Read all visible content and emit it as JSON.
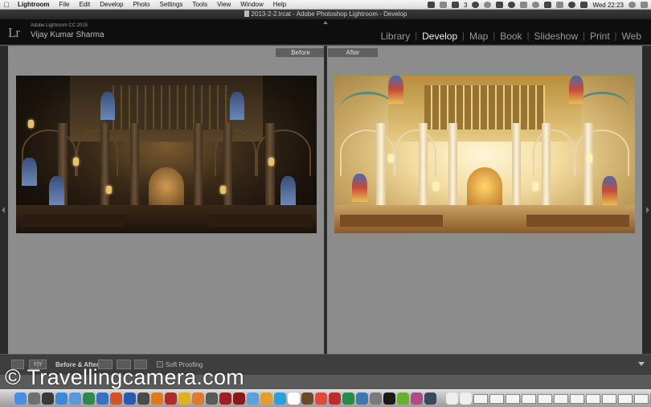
{
  "menubar": {
    "apple_icon": "apple-icon",
    "items": [
      "Lightroom",
      "File",
      "Edit",
      "Develop",
      "Photo",
      "Settings",
      "Tools",
      "View",
      "Window",
      "Help"
    ],
    "status_badge": "3",
    "clock": "Wed 22:23"
  },
  "window": {
    "title": "2013-2-2.lrcat - Adobe Photoshop Lightroom - Develop"
  },
  "identity_plate": {
    "logo": "Lr",
    "product": "Adobe Lightroom CC 2015",
    "user": "Vijay Kumar Sharma"
  },
  "modules": {
    "items": [
      "Library",
      "Develop",
      "Map",
      "Book",
      "Slideshow",
      "Print",
      "Web"
    ],
    "active": "Develop"
  },
  "view": {
    "before_label": "Before",
    "after_label": "After"
  },
  "toolbar": {
    "yy_label": "Y|Y",
    "before_after_label": "Before & After :",
    "soft_proofing_label": "Soft Proofing"
  },
  "watermark": "© Travellingcamera.com",
  "colors": {
    "panel_bg": "#2b2b2b",
    "canvas_gray": "#8c8c8c",
    "identity_bg": "#0e0e0e",
    "active_module": "#eeeeee",
    "inactive_module": "#9a9a9a"
  },
  "dock": {
    "apps": [
      {
        "icon": "finder-icon",
        "color": "#4a8ee0"
      },
      {
        "icon": "launchpad-icon",
        "color": "#707070"
      },
      {
        "icon": "mission-control-icon",
        "color": "#3a3a3a"
      },
      {
        "icon": "safari-icon",
        "color": "#3a8ad8"
      },
      {
        "icon": "mail-icon",
        "color": "#5a9ad8"
      },
      {
        "icon": "excel-icon",
        "color": "#2e8a4a"
      },
      {
        "icon": "globe-icon",
        "color": "#3a70c0"
      },
      {
        "icon": "powerpoint-icon",
        "color": "#d0542a"
      },
      {
        "icon": "word-icon",
        "color": "#2a5ab0"
      },
      {
        "icon": "app-store-icon",
        "color": "#4a4a4a"
      },
      {
        "icon": "vlc-icon",
        "color": "#e07a20"
      },
      {
        "icon": "red-app-icon",
        "color": "#b02a2a"
      },
      {
        "icon": "chrome-icon",
        "color": "#e0b020"
      },
      {
        "icon": "ibooks-icon",
        "color": "#e07a30"
      },
      {
        "icon": "preview-icon",
        "color": "#5a5a5a"
      },
      {
        "icon": "acrobat-icon",
        "color": "#a02020"
      },
      {
        "icon": "acrobat-dark-icon",
        "color": "#8a1a1a"
      },
      {
        "icon": "messages-icon",
        "color": "#5aa0e0"
      },
      {
        "icon": "photos-icon",
        "color": "#e0a030"
      },
      {
        "icon": "skype-icon",
        "color": "#2aa0e0"
      },
      {
        "icon": "calendar-icon",
        "color": "#ffffff"
      },
      {
        "icon": "bridge-icon",
        "color": "#6a4a2a"
      },
      {
        "icon": "chrome-alt-icon",
        "color": "#e04a3a"
      },
      {
        "icon": "pdf-icon",
        "color": "#c02a2a"
      },
      {
        "icon": "excel-alt-icon",
        "color": "#2a8a4a"
      },
      {
        "icon": "network-icon",
        "color": "#3a7ab0"
      },
      {
        "icon": "settings-icon",
        "color": "#7a7a7a"
      },
      {
        "icon": "terminal-icon",
        "color": "#1a1a1a"
      },
      {
        "icon": "android-icon",
        "color": "#6ab030"
      },
      {
        "icon": "photo-booth-icon",
        "color": "#b04a8a"
      },
      {
        "icon": "lightroom-icon",
        "color": "#3a4a5a"
      }
    ],
    "trailing": [
      "document-icon",
      "help-icon"
    ],
    "thumbs": 12,
    "trash_icon": "trash-icon"
  }
}
